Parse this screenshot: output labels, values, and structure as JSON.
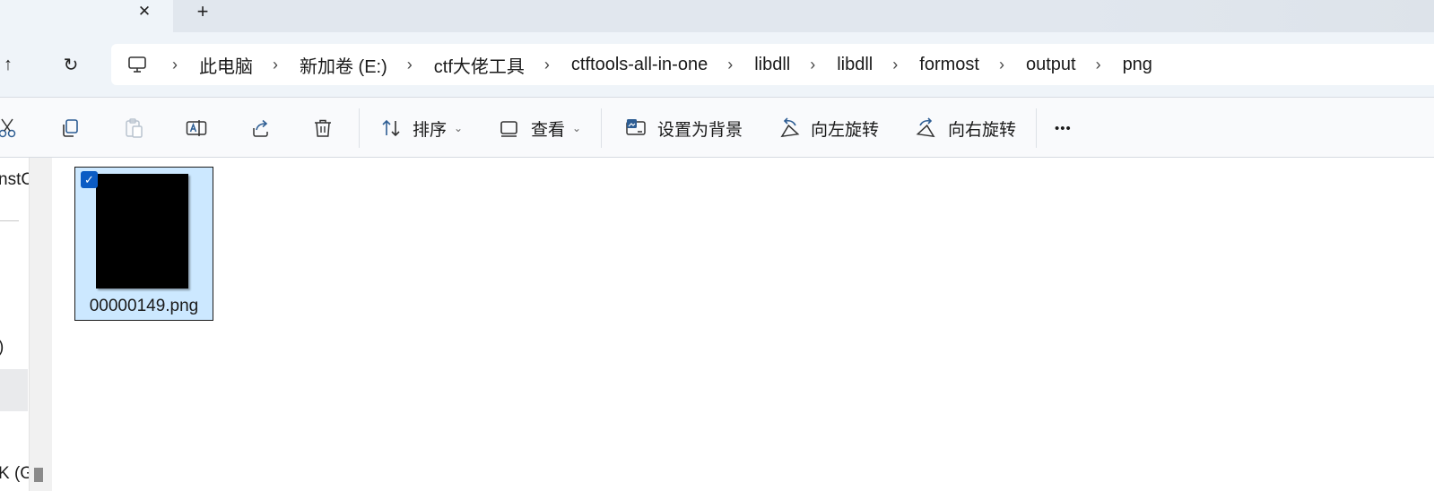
{
  "tab": {
    "close_glyph": "✕",
    "new_tab_glyph": "+"
  },
  "nav_buttons": {
    "up_glyph": "↑",
    "refresh_glyph": "↻"
  },
  "breadcrumb": {
    "separator": "›",
    "items": [
      "此电脑",
      "新加卷 (E:)",
      "ctf大佬工具",
      "ctftools-all-in-one",
      "libdll",
      "libdll",
      "formost",
      "output",
      "png"
    ]
  },
  "commandbar": {
    "sort_label": "排序",
    "view_label": "查看",
    "set_background_label": "设置为背景",
    "rotate_left_label": "向左旋转",
    "rotate_right_label": "向右旋转",
    "more_glyph": "•••",
    "chevron_glyph": "⌄"
  },
  "navpane": {
    "item1": "nstC",
    "item2": ")",
    "item3": "K (G"
  },
  "files": [
    {
      "name": "00000149.png",
      "selected": true,
      "check_glyph": "✓"
    }
  ],
  "colors": {
    "selection_bg": "#cce8ff",
    "checkbox_accent": "#0b5cc4",
    "chrome_bg": "#eff4f9"
  }
}
